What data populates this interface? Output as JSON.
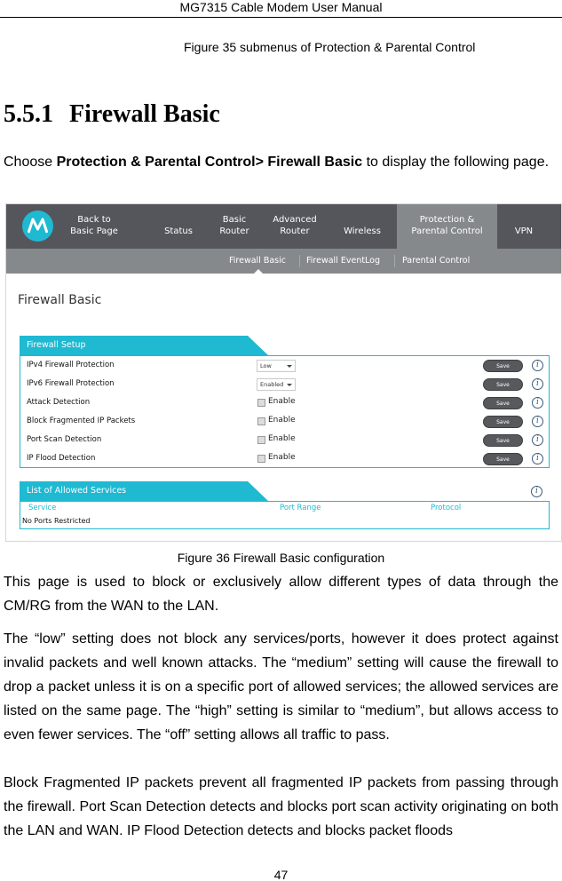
{
  "document": {
    "running_header": "MG7315 Cable Modem User Manual",
    "figure35_caption": "Figure 35 submenus of Protection & Parental Control",
    "section": {
      "number": "5.5.1",
      "title": "Firewall Basic"
    },
    "intro": {
      "prefix": "Choose ",
      "bold": "Protection & Parental Control> Firewall Basic",
      "suffix": " to display the following page."
    },
    "figure36_caption": "Figure 36 Firewall Basic configuration",
    "paragraphs": [
      "This page is used to block or exclusively allow different types of data through the CM/RG from the WAN to the LAN.",
      "The “low” setting does not block any services/ports, however it does protect against invalid packets and well known attacks. The “medium” setting will cause the firewall to drop a packet unless it is on a specific port of allowed services; the allowed services are listed on the same page. The “high” setting is similar to “medium”, but allows access to even fewer services. The “off” setting allows all traffic to pass.",
      "Block Fragmented IP packets prevent all fragmented IP packets from passing through the firewall.   Port Scan Detection detects and blocks port scan activity originating on both the LAN and WAN. IP Flood Detection detects and blocks packet floods"
    ],
    "page_number": "47"
  },
  "screenshot": {
    "brand_color": "#1fb9d2",
    "nav_bg": "#54565b",
    "logo": "motorola-logo",
    "nav": [
      {
        "line1": "Back to",
        "line2": "Basic Page"
      },
      {
        "line1": "",
        "line2": "Status"
      },
      {
        "line1": "Basic",
        "line2": "Router"
      },
      {
        "line1": "Advanced",
        "line2": "Router"
      },
      {
        "line1": "",
        "line2": "Wireless"
      },
      {
        "line1": "Protection &",
        "line2": "Parental Control",
        "active": true
      },
      {
        "line1": "",
        "line2": "VPN"
      }
    ],
    "subnav": [
      "Firewall Basic",
      "Firewall EventLog",
      "Parental Control"
    ],
    "subnav_active": "Firewall Basic",
    "page_title": "Firewall Basic",
    "firewall_setup": {
      "title": "Firewall Setup",
      "rows": [
        {
          "label": "IPv4 Firewall Protection",
          "type": "select",
          "value": "Low",
          "save": "Save",
          "info_icon": "info-icon"
        },
        {
          "label": "IPv6 Firewall Protection",
          "type": "select",
          "value": "Enabled",
          "save": "Save",
          "info_icon": "info-icon"
        },
        {
          "label": "Attack Detection",
          "type": "checkbox",
          "checkbox_label": "Enable",
          "checked": false,
          "save": "Save",
          "info_icon": "info-icon"
        },
        {
          "label": "Block Fragmented IP Packets",
          "type": "checkbox",
          "checkbox_label": "Enable",
          "checked": false,
          "save": "Save",
          "info_icon": "info-icon"
        },
        {
          "label": "Port Scan Detection",
          "type": "checkbox",
          "checkbox_label": "Enable",
          "checked": false,
          "save": "Save",
          "info_icon": "info-icon"
        },
        {
          "label": "IP Flood Detection",
          "type": "checkbox",
          "checkbox_label": "Enable",
          "checked": false,
          "save": "Save",
          "info_icon": "info-icon"
        }
      ]
    },
    "allowed_services": {
      "title": "List of Allowed Services",
      "columns": [
        "Service",
        "Port Range",
        "Protocol"
      ],
      "empty_text": "No Ports Restricted",
      "info_icon": "info-icon"
    },
    "info_glyph": "i"
  }
}
